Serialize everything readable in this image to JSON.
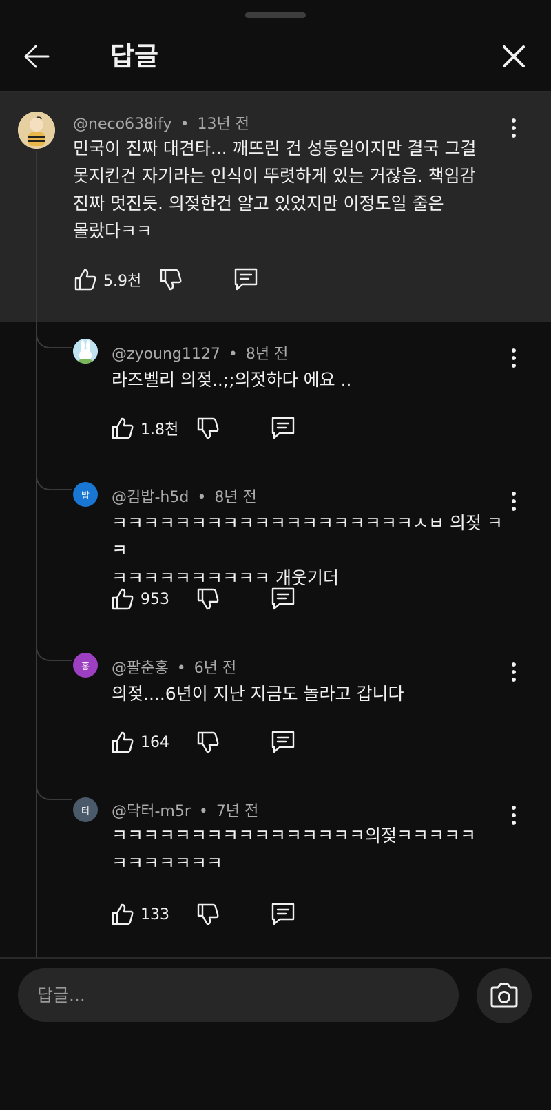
{
  "header": {
    "title": "답글"
  },
  "parent_comment": {
    "author": "@neco638ify",
    "time": "13년 전",
    "text": "민국이 진짜 대견타... 깨뜨린 건 성동일이지만 결국 그걸\n못지킨건 자기라는 인식이 뚜렷하게 있는 거잖음. 책임감\n진짜 멋진듯. 의젖한건 알고 있었지만 이정도일 줄은\n몰랐다ㅋㅋ",
    "likes": "5.9천"
  },
  "replies": [
    {
      "author": "@zyoung1127",
      "time": "8년 전",
      "text": "라즈벨리 의젖..;;의젓하다 에요 ..",
      "likes": "1.8천",
      "avatar_color": "#bfe3f0",
      "avatar_letter": ""
    },
    {
      "author": "@김밥-h5d",
      "time": "8년 전",
      "text": "ㅋㅋㅋㅋㅋㅋㅋㅋㅋㅋㅋㅋㅋㅋㅋㅋㅋㅋㅋㅅㅂ 의젖 ㅋㅋ\nㅋㅋㅋㅋㅋㅋㅋㅋㅋㅋ 개웃기더",
      "likes": "953",
      "avatar_color": "#1976d2",
      "avatar_letter": "밥"
    },
    {
      "author": "@팔춘홍",
      "time": "6년 전",
      "text": "의젖....6년이 지난 지금도 놀라고 갑니다",
      "likes": "164",
      "avatar_color": "#9c3fc0",
      "avatar_letter": "홍"
    },
    {
      "author": "@닥터-m5r",
      "time": "7년 전",
      "text": "ㅋㅋㅋㅋㅋㅋㅋㅋㅋㅋㅋㅋㅋㅋㅋㅋ의젖ㅋㅋㅋㅋㅋ\nㅋㅋㅋㅋㅋㅋㅋ",
      "likes": "133",
      "avatar_color": "#4a5a6a",
      "avatar_letter": "터"
    }
  ],
  "reply_box": {
    "placeholder": "답글..."
  },
  "icons": [
    "arrow-left-icon",
    "close-icon",
    "more-vert-icon",
    "thumb-up-icon",
    "thumb-down-icon",
    "reply-icon",
    "camera-icon"
  ]
}
